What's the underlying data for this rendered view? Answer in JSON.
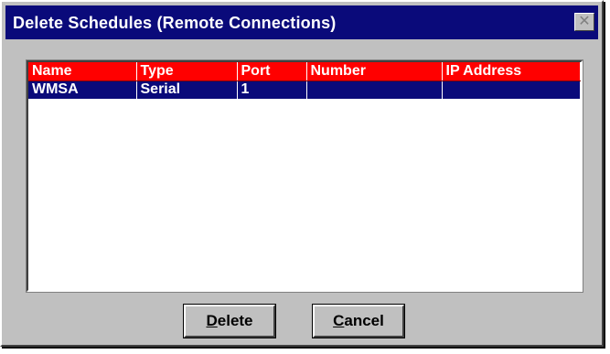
{
  "window": {
    "title": "Delete Schedules (Remote Connections)",
    "close_glyph": "✕"
  },
  "table": {
    "columns": [
      "Name",
      "Type",
      "Port",
      "Number",
      "IP Address"
    ],
    "rows": [
      {
        "name": "WMSA",
        "type": "Serial",
        "port": "1",
        "number": "",
        "ip_address": "",
        "selected": true
      }
    ]
  },
  "buttons": {
    "delete": {
      "mnemonic": "D",
      "rest": "elete"
    },
    "cancel": {
      "mnemonic": "C",
      "rest": "ancel"
    }
  },
  "colors": {
    "titlebar": "#0a0a7a",
    "header": "#ff0000",
    "selection": "#0a0a7a",
    "face": "#c0c0c0"
  },
  "icons": {
    "close": "close-icon"
  }
}
